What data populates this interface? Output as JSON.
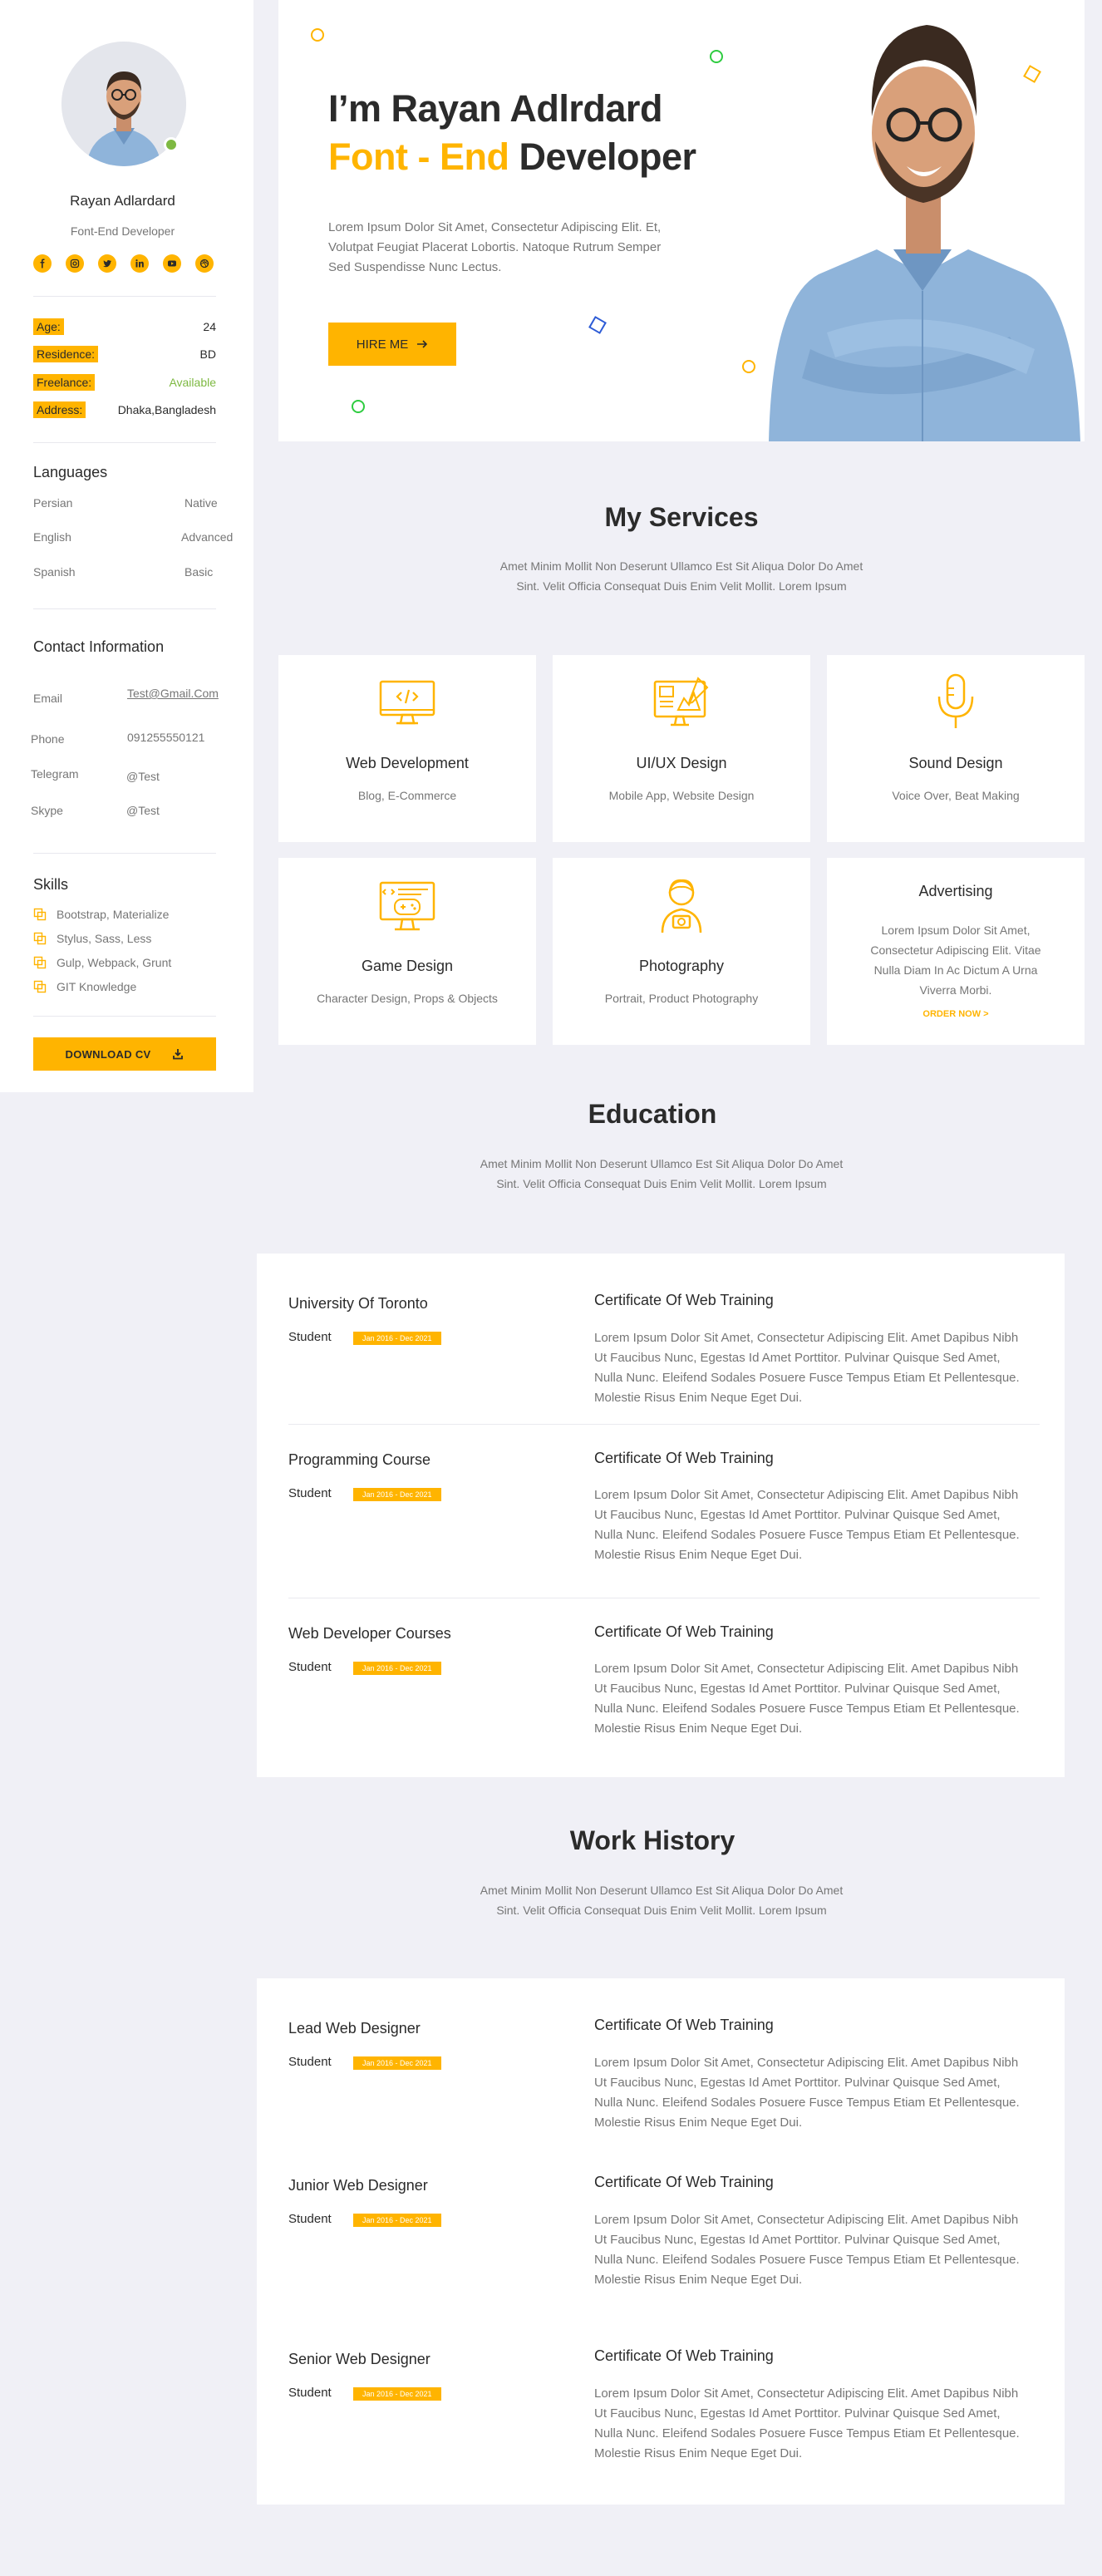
{
  "profile": {
    "name": "Rayan Adlardard",
    "role": "Font-End Developer",
    "socials": [
      "facebook-icon",
      "instagram-icon",
      "twitter-icon",
      "linkedin-icon",
      "youtube-icon",
      "dribbble-icon"
    ]
  },
  "info": [
    {
      "label": "Age:",
      "value": "24"
    },
    {
      "label": "Residence:",
      "value": "BD"
    },
    {
      "label": "Freelance:",
      "value": "Available"
    },
    {
      "label": "Address:",
      "value": "Dhaka,Bangladesh"
    }
  ],
  "languages": {
    "heading": "Languages",
    "items": [
      {
        "name": "Persian",
        "level": "Native"
      },
      {
        "name": "English",
        "level": "Advanced"
      },
      {
        "name": "Spanish",
        "level": "Basic"
      }
    ]
  },
  "contact": {
    "heading": "Contact Information",
    "items": [
      {
        "label": "Email",
        "value": "Test@Gmail.Com"
      },
      {
        "label": "Phone",
        "value": "091255550121"
      },
      {
        "label": "Telegram",
        "value": "@Test"
      },
      {
        "label": "Skype",
        "value": "@Test"
      }
    ]
  },
  "skills": {
    "heading": "Skills",
    "items": [
      "Bootstrap, Materialize",
      "Stylus, Sass, Less",
      "Gulp, Webpack, Grunt",
      "GIT Knowledge"
    ]
  },
  "download_cv": "DOWNLOAD CV",
  "hero": {
    "title_prefix": "I’m Rayan Adlrdard",
    "title_highlight": "Font - End",
    "title_suffix": "Developer",
    "description": "Lorem Ipsum Dolor Sit Amet, Consectetur Adipiscing Elit. Et, Volutpat Feugiat Placerat Lobortis. Natoque Rutrum Semper Sed Suspendisse Nunc Lectus.",
    "hire_label": "HIRE ME"
  },
  "services": {
    "title": "My Services",
    "subtitle": "Amet Minim Mollit Non Deserunt Ullamco Est Sit Aliqua Dolor Do Amet Sint. Velit Officia Consequat Duis Enim Velit Mollit. Lorem Ipsum",
    "cards": [
      {
        "title": "Web Development",
        "sub": "Blog, E-Commerce",
        "icon": "monitor-code-icon"
      },
      {
        "title": "UI/UX Design",
        "sub": "Mobile App, Website Design",
        "icon": "design-board-icon"
      },
      {
        "title": "Sound Design",
        "sub": "Voice Over, Beat Making",
        "icon": "microphone-icon"
      },
      {
        "title": "Game Design",
        "sub": "Character Design, Props & Objects",
        "icon": "game-monitor-icon"
      },
      {
        "title": "Photography",
        "sub": "Portrait, Product Photography",
        "icon": "photographer-icon"
      }
    ],
    "advertising": {
      "title": "Advertising",
      "desc": "Lorem Ipsum Dolor Sit Amet, Consectetur Adipiscing Elit. Vitae Nulla Diam In Ac Dictum A Urna Viverra Morbi.",
      "cta": "ORDER NOW >"
    }
  },
  "education": {
    "title": "Education",
    "subtitle": "Amet Minim Mollit Non Deserunt Ullamco Est Sit Aliqua Dolor Do Amet Sint. Velit Officia Consequat Duis Enim Velit Mollit. Lorem Ipsum",
    "entries": [
      {
        "title": "University Of Toronto",
        "role": "Student",
        "date": "Jan 2016 - Dec 2021",
        "right_title": "Certificate Of Web Training",
        "desc": "Lorem Ipsum Dolor Sit Amet, Consectetur Adipiscing Elit. Amet Dapibus Nibh Ut Faucibus Nunc, Egestas Id Amet Porttitor. Pulvinar Quisque Sed Amet, Nulla Nunc. Eleifend Sodales Posuere Fusce Tempus Etiam Et Pellentesque. Molestie Risus Enim Neque Eget Dui."
      },
      {
        "title": "Programming Course",
        "role": "Student",
        "date": "Jan 2016 - Dec 2021",
        "right_title": "Certificate Of Web Training",
        "desc": "Lorem Ipsum Dolor Sit Amet, Consectetur Adipiscing Elit. Amet Dapibus Nibh Ut Faucibus Nunc, Egestas Id Amet Porttitor. Pulvinar Quisque Sed Amet, Nulla Nunc. Eleifend Sodales Posuere Fusce Tempus Etiam Et Pellentesque. Molestie Risus Enim Neque Eget Dui."
      },
      {
        "title": "Web Developer Courses",
        "role": "Student",
        "date": "Jan 2016 - Dec 2021",
        "right_title": "Certificate Of Web Training",
        "desc": "Lorem Ipsum Dolor Sit Amet, Consectetur Adipiscing Elit. Amet Dapibus Nibh Ut Faucibus Nunc, Egestas Id Amet Porttitor. Pulvinar Quisque Sed Amet, Nulla Nunc. Eleifend Sodales Posuere Fusce Tempus Etiam Et Pellentesque. Molestie Risus Enim Neque Eget Dui."
      }
    ]
  },
  "work": {
    "title": "Work History",
    "subtitle": "Amet Minim Mollit Non Deserunt Ullamco Est Sit Aliqua Dolor Do Amet Sint. Velit Officia Consequat Duis Enim Velit Mollit. Lorem Ipsum",
    "entries": [
      {
        "title": "Lead Web Designer",
        "role": "Student",
        "date": "Jan 2016 - Dec 2021",
        "right_title": "Certificate Of Web Training",
        "desc": "Lorem Ipsum Dolor Sit Amet, Consectetur Adipiscing Elit. Amet Dapibus Nibh Ut Faucibus Nunc, Egestas Id Amet Porttitor. Pulvinar Quisque Sed Amet, Nulla Nunc. Eleifend Sodales Posuere Fusce Tempus Etiam Et Pellentesque. Molestie Risus Enim Neque Eget Dui."
      },
      {
        "title": "Junior Web Designer",
        "role": "Student",
        "date": "Jan 2016 - Dec 2021",
        "right_title": "Certificate Of Web Training",
        "desc": "Lorem Ipsum Dolor Sit Amet, Consectetur Adipiscing Elit. Amet Dapibus Nibh Ut Faucibus Nunc, Egestas Id Amet Porttitor. Pulvinar Quisque Sed Amet, Nulla Nunc. Eleifend Sodales Posuere Fusce Tempus Etiam Et Pellentesque. Molestie Risus Enim Neque Eget Dui."
      },
      {
        "title": "Senior Web Designer",
        "role": "Student",
        "date": "Jan 2016 - Dec 2021",
        "right_title": "Certificate Of Web Training",
        "desc": "Lorem Ipsum Dolor Sit Amet, Consectetur Adipiscing Elit. Amet Dapibus Nibh Ut Faucibus Nunc, Egestas Id Amet Porttitor. Pulvinar Quisque Sed Amet, Nulla Nunc. Eleifend Sodales Posuere Fusce Tempus Etiam Et Pellentesque. Molestie Risus Enim Neque Eget Dui."
      }
    ]
  },
  "colors": {
    "accent": "#FFB400",
    "available": "#7EB942",
    "text": "#2B2B2B",
    "muted": "#767676",
    "page_bg": "#F0F0F6"
  }
}
